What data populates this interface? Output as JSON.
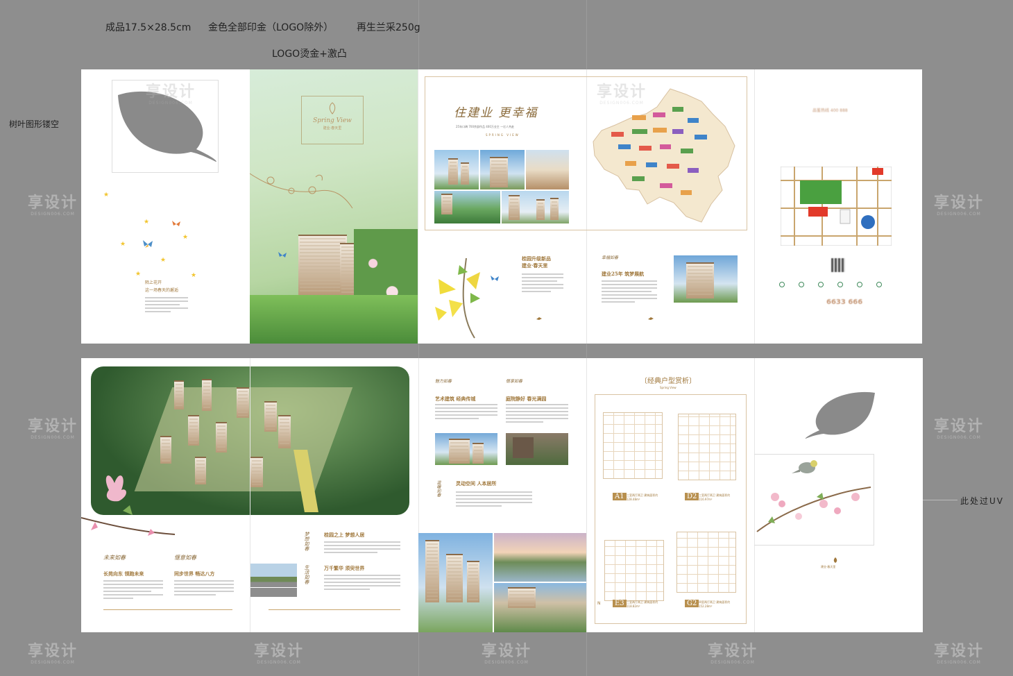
{
  "specs": {
    "size": "成品17.5×28.5cm",
    "gold_print": "金色全部印金（LOGO除外）",
    "paper": "再生兰采250g",
    "logo_finish": "LOGO烫金+激凸",
    "leaf_note": "树叶图形镂空",
    "uv_note": "此处过UV"
  },
  "watermark": {
    "brand": "享设计",
    "sub": "DESIGN006.COM"
  },
  "cover": {
    "logo_en": "Spring View",
    "logo_cn": "建业·春天里"
  },
  "back_flap": {
    "poem": [
      "陌上花开",
      "这一场春天的邂逅"
    ]
  },
  "inner_top": {
    "slogan": "住建业 更幸福",
    "sub": "25年口碑 700余部作品 400万业主 一亿人共赴",
    "tag": "SPRING VIEW",
    "feature_title": [
      "桂园升级新品",
      "建业·春天里"
    ],
    "section_brand": "幸福如春",
    "section_title": "建业25年 筑梦展航"
  },
  "back_panel": {
    "hotline_label": "品鉴热线 400 888",
    "phone": "6633 666"
  },
  "spread_bottom": {
    "head1": "未来如春",
    "head2": "惬意如春",
    "title1": "长苑向东 领跑未来",
    "title2": "同步世界 畅达八方",
    "vertical1": "梦想如春",
    "vertical2": "生活如春",
    "title3": "桂园之上 梦想人居",
    "title4": "万千繁华 须臾世界",
    "head3": "魅力如春",
    "head4": "惬享如春",
    "title5": "艺术建筑 经典传城",
    "title6": "庭院静好 春光满园",
    "head5": "温暖如春",
    "title7": "灵动空间 人本居所"
  },
  "floorplans": {
    "section": "〔经典户型赏析〕",
    "sub": "Spring View",
    "plans": [
      {
        "tag": "A1",
        "cap": "三室两厅两卫 建筑面积约128.48m²"
      },
      {
        "tag": "D2",
        "cap": "三室两厅两卫 建筑面积约116.97m²"
      },
      {
        "tag": "E3",
        "cap": "三室两厅两卫 建筑面积约118.82m²"
      },
      {
        "tag": "G2",
        "cap": "四室两厅两卫 建筑面积约152.28m²"
      }
    ]
  },
  "back_cover": {
    "logo_cn": "建业·春天里"
  },
  "colors": {
    "gold": "#a0783c",
    "background": "#8e8e8e",
    "green": "#3f8a5b"
  }
}
